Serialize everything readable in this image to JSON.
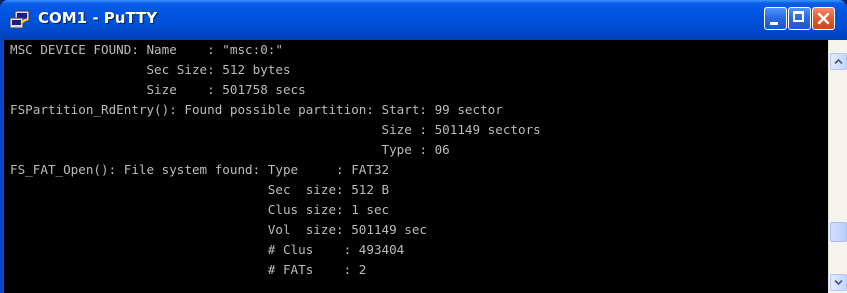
{
  "window": {
    "title": "COM1 - PuTTY",
    "icon": "putty-icon",
    "buttons": [
      "minimize-icon",
      "maximize-icon",
      "close-icon"
    ]
  },
  "terminal": {
    "lines": [
      "MSC DEVICE FOUND: Name    : \"msc:0:\"",
      "                  Sec Size: 512 bytes",
      "                  Size    : 501758 secs",
      "FSPartition_RdEntry(): Found possible partition: Start: 99 sector",
      "                                                 Size : 501149 sectors",
      "                                                 Type : 06",
      "FS_FAT_Open(): File system found: Type     : FAT32",
      "                                  Sec  size: 512 B",
      "                                  Clus size: 1 sec",
      "                                  Vol  size: 501149 sec",
      "                                  # Clus    : 493404",
      "                                  # FATs    : 2"
    ]
  },
  "colors": {
    "titlebar": "#0054e3",
    "terminal_bg": "#000000",
    "terminal_fg": "#bbbbbb",
    "close_button": "#e15a30"
  }
}
